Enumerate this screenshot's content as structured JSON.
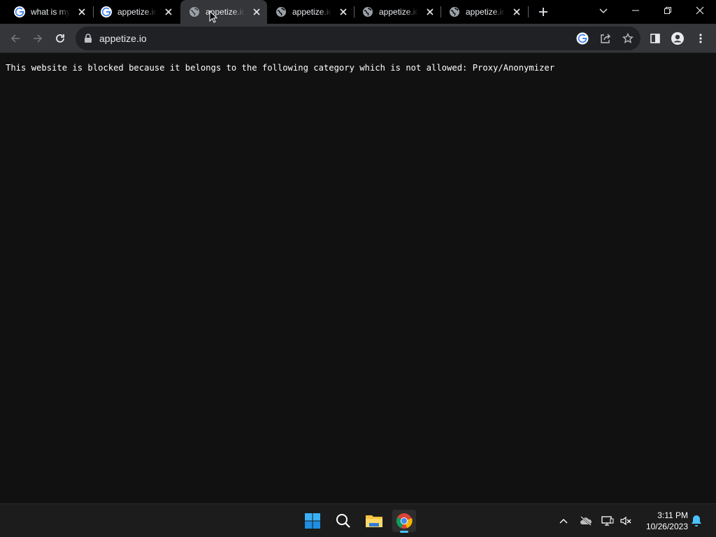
{
  "tabs": [
    {
      "title": "what is my",
      "favicon": "google-icon",
      "active": false
    },
    {
      "title": "appetize.io",
      "favicon": "google-icon",
      "active": false
    },
    {
      "title": "appetize.io",
      "favicon": "globe-icon",
      "active": true
    },
    {
      "title": "appetize.io",
      "favicon": "globe-icon",
      "active": false
    },
    {
      "title": "appetize.io",
      "favicon": "globe-icon",
      "active": false
    },
    {
      "title": "appetize.io",
      "favicon": "globe-icon",
      "active": false
    }
  ],
  "address_bar": {
    "url": "appetize.io"
  },
  "page": {
    "message": "This website is blocked because it belongs to the following category which is not allowed: Proxy/Anonymizer"
  },
  "taskbar": {
    "apps": [
      "windows-start-icon",
      "search-icon",
      "file-explorer-icon",
      "chrome-icon"
    ],
    "time": "3:11 PM",
    "date": "10/26/2023"
  },
  "colors": {
    "tab_strip": "#000000",
    "toolbar": "#35363a",
    "omnibox": "#202124",
    "content_bg": "#111111",
    "taskbar": "#1c1c1c",
    "accent": "#4cc2ff"
  }
}
